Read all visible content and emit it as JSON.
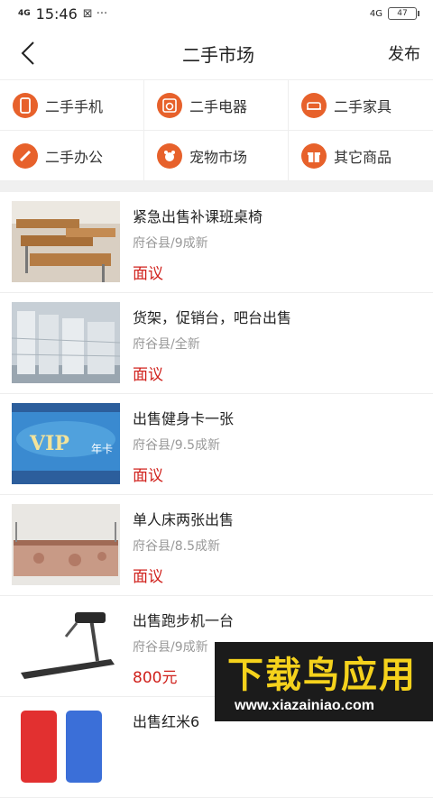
{
  "status": {
    "network": "4G",
    "time": "15:46",
    "extra": "⊠ ···",
    "sim": "4G",
    "battery": "47"
  },
  "nav": {
    "title": "二手市场",
    "publish": "发布"
  },
  "categories": [
    {
      "label": "二手手机",
      "icon": "phone-icon"
    },
    {
      "label": "二手电器",
      "icon": "appliance-icon"
    },
    {
      "label": "二手家具",
      "icon": "sofa-icon"
    },
    {
      "label": "二手办公",
      "icon": "pencil-icon"
    },
    {
      "label": "宠物市场",
      "icon": "pet-icon"
    },
    {
      "label": "其它商品",
      "icon": "gift-icon"
    }
  ],
  "items": [
    {
      "title": "紧急出售补课班桌椅",
      "meta": "府谷县/9成新",
      "price": "面议"
    },
    {
      "title": "货架，促销台，吧台出售",
      "meta": "府谷县/全新",
      "price": "面议"
    },
    {
      "title": "出售健身卡一张",
      "meta": "府谷县/9.5成新",
      "price": "面议"
    },
    {
      "title": "单人床两张出售",
      "meta": "府谷县/8.5成新",
      "price": "面议"
    },
    {
      "title": "出售跑步机一台",
      "meta": "府谷县/9成新",
      "price": "800元"
    },
    {
      "title": "出售红米6",
      "meta": "",
      "price": ""
    }
  ],
  "watermark": {
    "big": "下载鸟应用",
    "small": "www.xiazainiao.com"
  }
}
